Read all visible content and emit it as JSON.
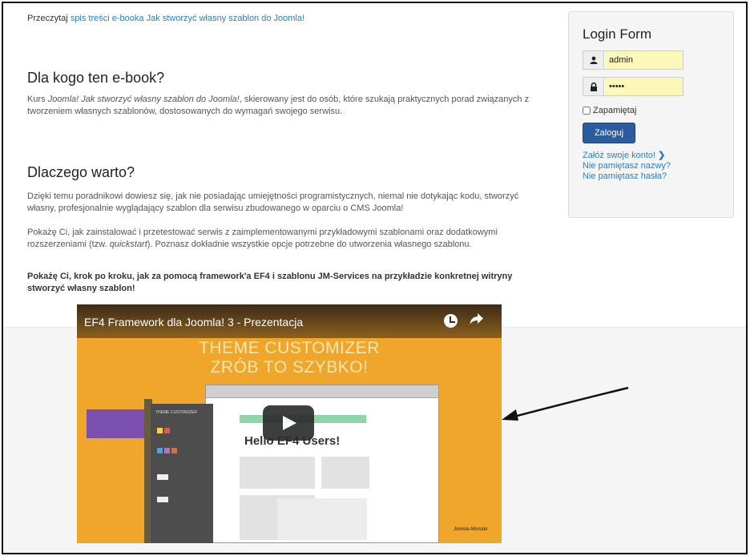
{
  "intro": {
    "prefix": "Przeczytaj",
    "link": "spis treści e-booka Jak stworzyć własny szablon do Joomla!"
  },
  "section1": {
    "heading": "Dla kogo ten e-book?",
    "text_start": "Kurs ",
    "text_em": "Joomla! Jak stworzyć własny szablon do Joomla!",
    "text_end": ", skierowany jest do osób, które szukają praktycznych porad związanych z tworzeniem własnych szablonów, dostosowanych do wymagań swojego serwisu."
  },
  "section2": {
    "heading": "Dlaczego warto?",
    "p1": "Dzięki temu poradnikowi dowiesz się, jak nie posiadając umiejętności programistycznych, niemal nie dotykając kodu, stworzyć własny, profesjonalnie wyglądający szablon dla serwisu zbudowanego w oparciu o CMS Joomla!",
    "p2_start": "Pokażę Ci, jak zainstalować i przetestować serwis z zaimplementowanymi przykładowymi szablonami oraz dodatkowymi rozszerzeniami (tzw. ",
    "p2_em": "quickstart",
    "p2_end": "). Poznasz dokładnie wszystkie opcje potrzebne do utworzenia własnego szablonu.",
    "p3": "Pokażę Ci, krok po kroku, jak za pomocą framework'a EF4 i szablonu JM-Services na przykładzie konkretnej witryny stworzyć własny szablon!"
  },
  "login": {
    "title": "Login Form",
    "username": "admin",
    "password": "•••••",
    "remember": "Zapamiętaj",
    "submit": "Zaloguj",
    "link_register": "Załóż swoje konto!",
    "link_register_arrow": "❯",
    "link_forgot_name": "Nie pamiętasz nazwy?",
    "link_forgot_pass": "Nie pamiętasz hasła?",
    "user_icon": "user-icon",
    "lock_icon": "lock-icon"
  },
  "video": {
    "title": "EF4 Framework dla Joomla! 3 - Prezentacja",
    "banner_line1": "THEME CUSTOMIZER",
    "banner_line2": "ZRÓB TO SZYBKO!",
    "hello": "Hello EF4 Users!",
    "panel_label": "THEME CUSTOMIZER",
    "brand": "Joomla-Monster",
    "icons": [
      "clock-icon",
      "share-icon",
      "play-icon"
    ]
  },
  "colors": {
    "link": "#2a7fc4",
    "button": "#2b5c9f",
    "input_bg": "#fcf8b8",
    "video_bg": "#efa62a"
  }
}
